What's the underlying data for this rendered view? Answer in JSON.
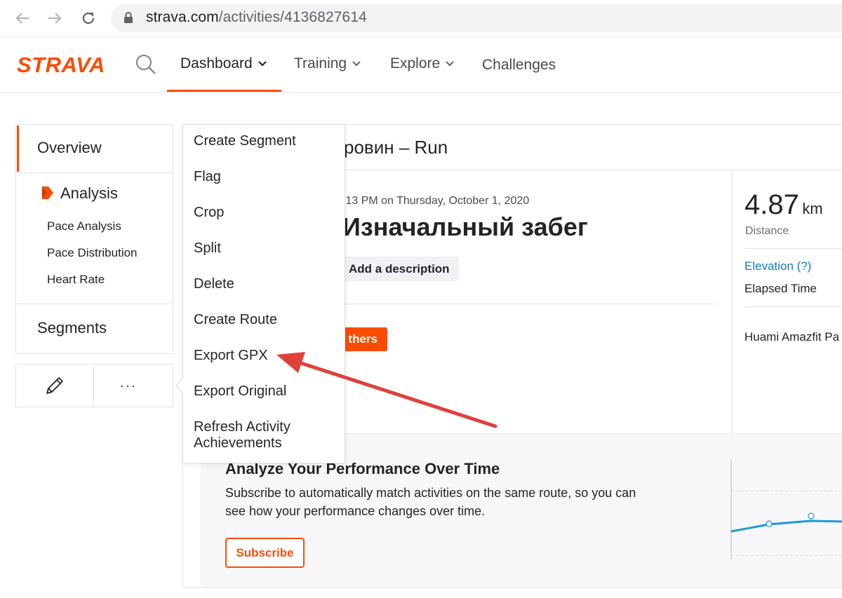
{
  "browser": {
    "url_domain": "strava.com",
    "url_path": "/activities/4136827614"
  },
  "header": {
    "logo": "STRAVA",
    "nav": [
      {
        "label": "Dashboard"
      },
      {
        "label": "Training"
      },
      {
        "label": "Explore"
      },
      {
        "label": "Challenges"
      }
    ]
  },
  "sidebar": {
    "overview": "Overview",
    "analysis": "Analysis",
    "analysis_items": [
      "Pace Analysis",
      "Pace Distribution",
      "Heart Rate"
    ],
    "segments": "Segments",
    "more_icon": "···"
  },
  "activity": {
    "title_partial": "ровин – Run",
    "datetime_partial": ":13 PM on Thursday, October 1, 2020",
    "name_partial": "Изначальный забег",
    "add_description": "Add a description",
    "others_button": "thers"
  },
  "stats": {
    "distance_value": "4.87",
    "distance_unit": "km",
    "distance_label": "Distance",
    "elevation_label": "Elevation (?)",
    "elapsed_label": "Elapsed Time",
    "device": "Huami Amazfit Pa"
  },
  "menu": {
    "items": [
      "Create Segment",
      "Flag",
      "Crop",
      "Split",
      "Delete",
      "Create Route",
      "Export GPX",
      "Export Original",
      "Refresh Activity",
      "Achievements"
    ]
  },
  "analyze": {
    "title": "Analyze Your Performance Over Time",
    "body_line1": "Subscribe to automatically match activities on the same route, so you can",
    "body_line2": "see how your performance changes over time.",
    "subscribe": "Subscribe"
  },
  "colors": {
    "brand": "#fc4c02",
    "link": "#0f7bc4",
    "arrow": "#e0403a"
  }
}
